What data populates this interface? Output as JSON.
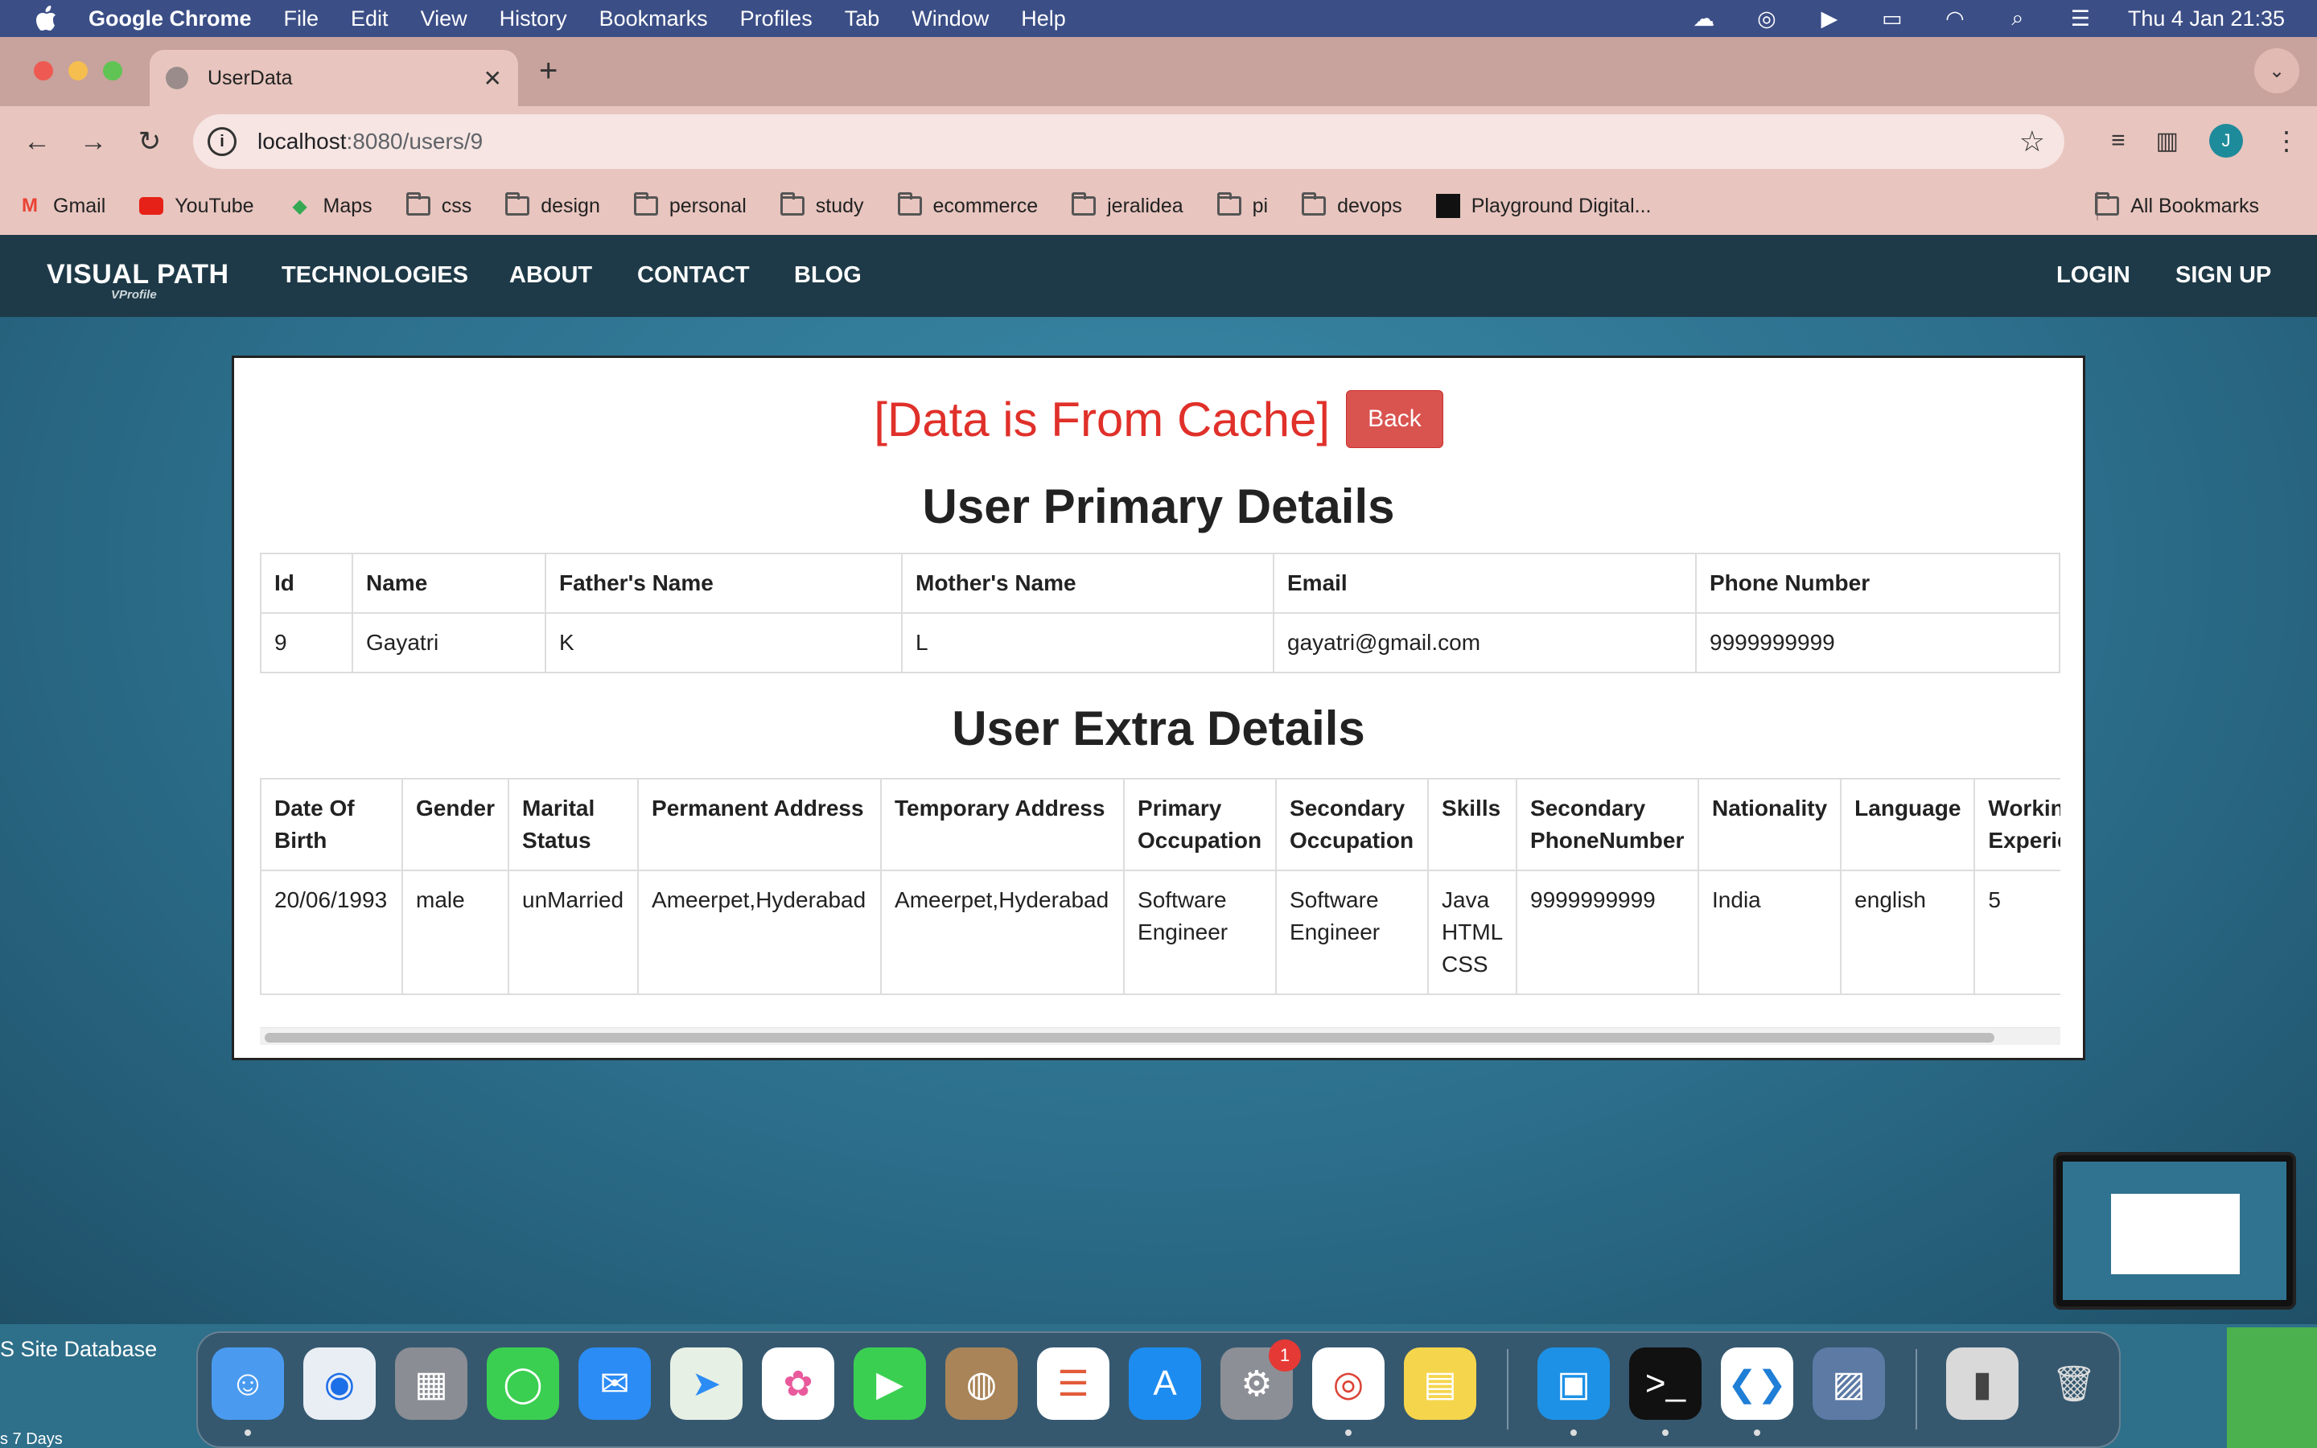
{
  "menubar": {
    "app_name": "Google Chrome",
    "items": [
      "File",
      "Edit",
      "View",
      "History",
      "Bookmarks",
      "Profiles",
      "Tab",
      "Window",
      "Help"
    ],
    "clock": "Thu 4 Jan  21:35"
  },
  "browser": {
    "tab_title": "UserData",
    "url_host": "localhost",
    "url_path": ":8080/users/9",
    "profile_initial": "J",
    "bookmarks": [
      "Gmail",
      "YouTube",
      "Maps",
      "css",
      "design",
      "personal",
      "study",
      "ecommerce",
      "jeralidea",
      "pi",
      "devops",
      "Playground Digital..."
    ],
    "all_bookmarks": "All Bookmarks"
  },
  "site": {
    "logo": "VISUAL PATH",
    "logo_sub": "VProfile",
    "nav": [
      "TECHNOLOGIES",
      "ABOUT",
      "CONTACT",
      "BLOG"
    ],
    "login": "LOGIN",
    "signup": "SIGN UP"
  },
  "panel": {
    "cache_message": "[Data is From Cache]",
    "back_label": "Back",
    "primary_title": "User Primary Details",
    "primary_headers": [
      "Id",
      "Name",
      "Father's Name",
      "Mother's Name",
      "Email",
      "Phone Number"
    ],
    "primary_row": [
      "9",
      "Gayatri",
      "K",
      "L",
      "gayatri@gmail.com",
      "9999999999"
    ],
    "extra_title": "User Extra Details",
    "extra_headers": [
      "Date Of Birth",
      "Gender",
      "Marital Status",
      "Permanent Address",
      "Temporary Address",
      "Primary Occupation",
      "Secondary Occupation",
      "Skills",
      "Secondary PhoneNumber",
      "Nationality",
      "Language",
      "Working Experience"
    ],
    "extra_row": [
      "20/06/1993",
      "male",
      "unMarried",
      "Ameerpet,Hyderabad",
      "Ameerpet,Hyderabad",
      "Software Engineer",
      "Software Engineer",
      "Java HTML CSS",
      "9999999999",
      "India",
      "english",
      "5"
    ]
  },
  "desktop": {
    "side_text": "S Site Database",
    "side_text2": "s 7 Days",
    "dock_badge": "1"
  },
  "colors": {
    "menubar": "#3b4e86",
    "tabstrip": "#c8a29c",
    "toolbar": "#e8c5bf",
    "site_nav": "#1e3a48",
    "cache_red": "#e0302a",
    "back_button": "#d9534f"
  }
}
